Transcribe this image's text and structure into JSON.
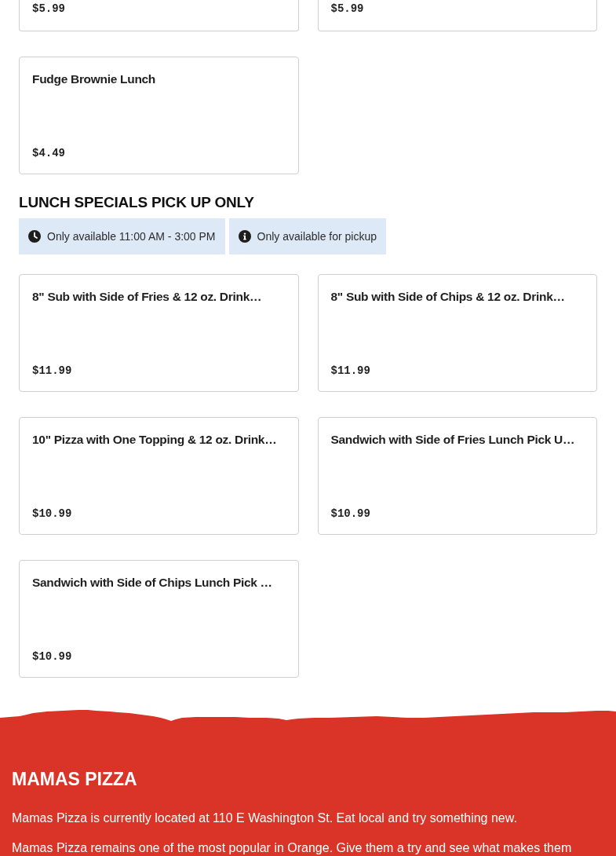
{
  "menu_sections": [
    {
      "items": [
        {
          "price": "$5.99"
        },
        {
          "price": "$5.99"
        },
        {
          "name": "Fudge Brownie Lunch",
          "price": "$4.49"
        }
      ]
    },
    {
      "title": "LUNCH SPECIALS PICK UP ONLY",
      "notices": [
        {
          "kind": "hours",
          "text": "Only available 11:00 AM - 3:00 PM"
        },
        {
          "kind": "info",
          "text": "Only available for pickup"
        }
      ],
      "items": [
        {
          "name": "8\" Sub with Side of Fries & 12 oz. Drink…",
          "price": "$11.99"
        },
        {
          "name": "8\" Sub with Side of Chips & 12 oz. Drink…",
          "price": "$11.99"
        },
        {
          "name": "10\" Pizza with One Topping & 12 oz. Drink…",
          "price": "$10.99"
        },
        {
          "name": "Sandwich with Side of Fries Lunch Pick U…",
          "price": "$10.99"
        },
        {
          "name": "Sandwich with Side of Chips Lunch Pick …",
          "price": "$10.99"
        }
      ]
    }
  ],
  "footer": {
    "title": "MAMAS PIZZA",
    "paragraphs": [
      "Mamas Pizza is currently located at 110 E Washington St. Eat local and try something new.",
      "Mamas Pizza remains one of the most popular in Orange. Give them a try and see what makes them"
    ]
  }
}
